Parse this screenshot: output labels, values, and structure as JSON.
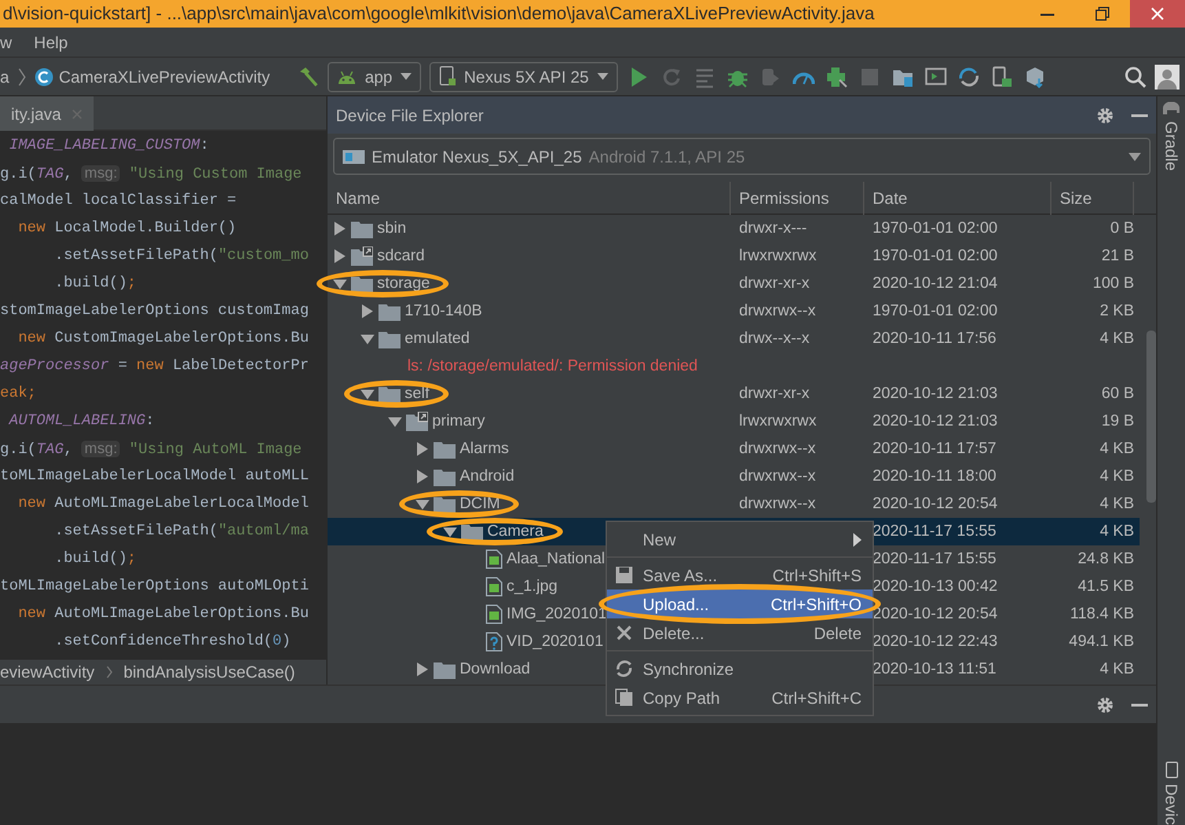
{
  "window": {
    "title": "d\\vision-quickstart] - ...\\app\\src\\main\\java\\com\\google\\mlkit\\vision\\demo\\java\\CameraXLivePreviewActivity.java"
  },
  "menu_bar": [
    "w",
    "Help"
  ],
  "toolbar": {
    "breadcrumb_cut": "a",
    "file": "CameraXLivePreviewActivity",
    "config": "app",
    "device": "Nexus 5X API 25"
  },
  "editor": {
    "tab": "ity.java",
    "lines": [
      [
        {
          "kind": "const",
          "text": " IMAGE_LABELING_CUSTOM"
        },
        {
          "kind": "plain",
          "text": ":"
        }
      ],
      [
        {
          "kind": "plain",
          "text": "g.i("
        },
        {
          "kind": "const",
          "text": "TAG"
        },
        {
          "kind": "plain",
          "text": ", "
        },
        {
          "kind": "hint",
          "text": "msg:"
        },
        {
          "kind": "str",
          "text": " \"Using Custom Image"
        }
      ],
      [
        {
          "kind": "plain",
          "text": "calModel localClassifier ="
        }
      ],
      [
        {
          "kind": "kw",
          "text": "  new "
        },
        {
          "kind": "plain",
          "text": "LocalModel.Builder()"
        }
      ],
      [
        {
          "kind": "plain",
          "text": "      .setAssetFilePath("
        },
        {
          "kind": "str",
          "text": "\"custom_mo"
        }
      ],
      [
        {
          "kind": "plain",
          "text": "      .build()"
        },
        {
          "kind": "kw",
          "text": ";"
        }
      ],
      [
        {
          "kind": "plain",
          "text": "stomImageLabelerOptions customImag"
        }
      ],
      [
        {
          "kind": "kw",
          "text": "  new "
        },
        {
          "kind": "plain",
          "text": "CustomImageLabelerOptions.Bu"
        }
      ],
      [
        {
          "kind": "const",
          "text": "ageProcessor"
        },
        {
          "kind": "plain",
          "text": " = "
        },
        {
          "kind": "kw",
          "text": "new "
        },
        {
          "kind": "plain",
          "text": "LabelDetectorPr"
        }
      ],
      [
        {
          "kind": "kw",
          "text": "eak;"
        }
      ],
      [
        {
          "kind": "const",
          "text": " AUTOML_LABELING"
        },
        {
          "kind": "plain",
          "text": ":"
        }
      ],
      [
        {
          "kind": "plain",
          "text": "g.i("
        },
        {
          "kind": "const",
          "text": "TAG"
        },
        {
          "kind": "plain",
          "text": ", "
        },
        {
          "kind": "hint",
          "text": "msg:"
        },
        {
          "kind": "str",
          "text": " \"Using AutoML Image"
        }
      ],
      [
        {
          "kind": "plain",
          "text": "toMLImageLabelerLocalModel autoMLL"
        }
      ],
      [
        {
          "kind": "kw",
          "text": "  new "
        },
        {
          "kind": "plain",
          "text": "AutoMLImageLabelerLocalModel"
        }
      ],
      [
        {
          "kind": "plain",
          "text": "      .setAssetFilePath("
        },
        {
          "kind": "str",
          "text": "\"automl/ma"
        }
      ],
      [
        {
          "kind": "plain",
          "text": "      .build()"
        },
        {
          "kind": "kw",
          "text": ";"
        }
      ],
      [
        {
          "kind": "plain",
          "text": "toMLImageLabelerOptions autoMLOpti"
        }
      ],
      [
        {
          "kind": "kw",
          "text": "  new "
        },
        {
          "kind": "plain",
          "text": "AutoMLImageLabelerOptions.Bu"
        }
      ],
      [
        {
          "kind": "plain",
          "text": "      .setConfidenceThreshold("
        },
        {
          "kind": "num",
          "text": "0"
        },
        {
          "kind": "plain",
          "text": ")"
        }
      ]
    ],
    "breadcrumbs": [
      "eviewActivity",
      "bindAnalysisUseCase()"
    ]
  },
  "device_file_explorer": {
    "title": "Device File Explorer",
    "device": "Emulator Nexus_5X_API_25",
    "device_detail": "Android 7.1.1, API 25",
    "columns": [
      "Name",
      "Permissions",
      "Date",
      "Size"
    ],
    "rows": [
      {
        "kind": "folder",
        "name": "sbin",
        "expanded": false,
        "circled": false,
        "selected": false,
        "permissions": "drwxr-x---",
        "date": "1970-01-01 02:00",
        "size": "0 B"
      },
      {
        "kind": "link",
        "name": "sdcard",
        "expanded": false,
        "circled": false,
        "selected": false,
        "permissions": "lrwxrwxrwx",
        "date": "1970-01-01 02:00",
        "size": "21 B"
      },
      {
        "kind": "folder",
        "name": "storage",
        "expanded": true,
        "circled": true,
        "selected": false,
        "permissions": "drwxr-xr-x",
        "date": "2020-10-12 21:04",
        "size": "100 B",
        "children": [
          {
            "kind": "folder",
            "name": "1710-140B",
            "expanded": false,
            "circled": false,
            "selected": false,
            "permissions": "drwxrwx--x",
            "date": "1970-01-01 02:00",
            "size": "2 KB"
          },
          {
            "kind": "folder",
            "name": "emulated",
            "expanded": true,
            "circled": false,
            "selected": false,
            "permissions": "drwx--x--x",
            "date": "2020-10-11 17:56",
            "size": "4 KB",
            "children": [
              {
                "kind": "error",
                "name": "ls: /storage/emulated/: Permission denied",
                "circled": false,
                "selected": false
              }
            ]
          },
          {
            "kind": "folder",
            "name": "self",
            "expanded": true,
            "circled": true,
            "selected": false,
            "permissions": "drwxr-xr-x",
            "date": "2020-10-12 21:03",
            "size": "60 B",
            "children": [
              {
                "kind": "link",
                "name": "primary",
                "expanded": true,
                "circled": false,
                "selected": false,
                "permissions": "lrwxrwxrwx",
                "date": "2020-10-12 21:03",
                "size": "19 B",
                "children": [
                  {
                    "kind": "folder",
                    "name": "Alarms",
                    "expanded": false,
                    "circled": false,
                    "selected": false,
                    "permissions": "drwxrwx--x",
                    "date": "2020-10-11 17:57",
                    "size": "4 KB"
                  },
                  {
                    "kind": "folder",
                    "name": "Android",
                    "expanded": false,
                    "circled": false,
                    "selected": false,
                    "permissions": "drwxrwx--x",
                    "date": "2020-10-11 18:00",
                    "size": "4 KB"
                  },
                  {
                    "kind": "folder",
                    "name": "DCIM",
                    "expanded": true,
                    "circled": true,
                    "selected": false,
                    "permissions": "drwxrwx--x",
                    "date": "2020-10-12 20:54",
                    "size": "4 KB",
                    "children": [
                      {
                        "kind": "folder",
                        "name": "Camera",
                        "expanded": true,
                        "circled": true,
                        "selected": true,
                        "date": "2020-11-17 15:55",
                        "size": "4 KB",
                        "children": [
                          {
                            "kind": "image",
                            "name": "Alaa_National",
                            "circled": false,
                            "selected": false,
                            "date": "2020-11-17 15:55",
                            "size": "24.8 KB"
                          },
                          {
                            "kind": "image",
                            "name": "c_1.jpg",
                            "circled": false,
                            "selected": false,
                            "date": "2020-10-13 00:42",
                            "size": "41.5 KB"
                          },
                          {
                            "kind": "image",
                            "name": "IMG_2020101",
                            "circled": false,
                            "selected": false,
                            "date": "2020-10-12 20:54",
                            "size": "118.4 KB"
                          },
                          {
                            "kind": "unknown",
                            "name": "VID_2020101",
                            "circled": false,
                            "selected": false,
                            "date": "2020-10-12 22:43",
                            "size": "494.1 KB"
                          }
                        ]
                      }
                    ]
                  },
                  {
                    "kind": "folder",
                    "name": "Download",
                    "expanded": false,
                    "circled": false,
                    "selected": false,
                    "date": "2020-10-13 11:51",
                    "size": "4 KB"
                  }
                ]
              }
            ]
          }
        ]
      }
    ]
  },
  "context_menu": {
    "items": [
      {
        "kind": "submenu",
        "label": "New",
        "selected": false,
        "circled": false
      },
      {
        "kind": "separator"
      },
      {
        "kind": "save",
        "label": "Save As...",
        "shortcut": "Ctrl+Shift+S",
        "selected": false,
        "circled": false
      },
      {
        "kind": "upload",
        "label": "Upload...",
        "shortcut": "Ctrl+Shift+O",
        "selected": true,
        "circled": true
      },
      {
        "kind": "delete",
        "label": "Delete...",
        "shortcut": "Delete",
        "selected": false,
        "circled": false
      },
      {
        "kind": "separator"
      },
      {
        "kind": "sync",
        "label": "Synchronize",
        "selected": false,
        "circled": false
      },
      {
        "kind": "copy",
        "label": "Copy Path",
        "shortcut": "Ctrl+Shift+C",
        "selected": false,
        "circled": false
      }
    ]
  },
  "right_strip": {
    "top": "Gradle",
    "bottom": "Devic"
  }
}
